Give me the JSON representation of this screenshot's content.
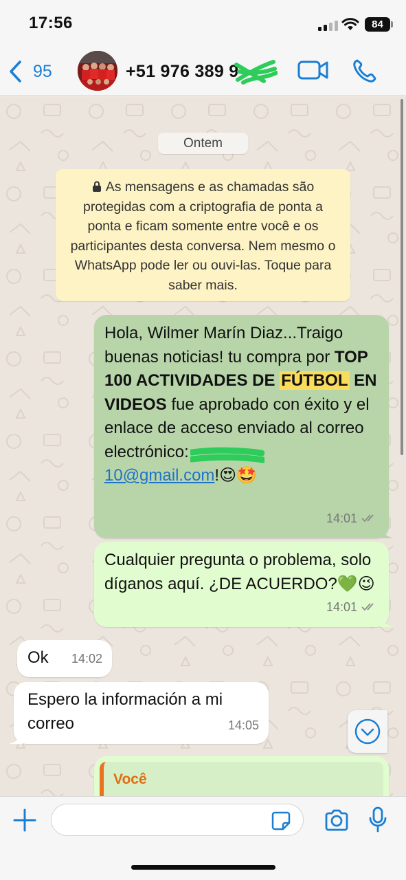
{
  "status_bar": {
    "time": "17:56",
    "battery": "84"
  },
  "header": {
    "back_count": "95",
    "contact_name": "+51 976 389 9",
    "icons": [
      "chevron-left-icon",
      "video-call-icon",
      "phone-icon"
    ]
  },
  "chat": {
    "date_chip": "Ontem",
    "encryption_notice": "As mensagens e as chamadas são protegidas com a criptografia de ponta a ponta e ficam somente entre você e os participantes desta conversa. Nem mesmo o WhatsApp pode ler ou ouvi-las. Toque para saber mais.",
    "messages": [
      {
        "direction": "outgoing",
        "greeting": "Hola, Wilmer Marín Diaz...Traigo buenas noticias! tu compra por ",
        "product_part1": "TOP 100 ACTIVIDADES DE ",
        "product_highlight": "FÚTBOL",
        "product_part2": " EN VIDEOS",
        "body": " fue aprobado con éxito y el enlace de acceso enviado al correo electrónico: ",
        "email": "10@gmail.com",
        "suffix": "!😍🤩",
        "time": "14:01",
        "status": "read"
      },
      {
        "direction": "outgoing",
        "text": "Cualquier pregunta o problema, solo díganos aquí. ¿DE ACUERDO?💚😉",
        "time": "14:01",
        "status": "read"
      },
      {
        "direction": "incoming",
        "text": "Ok",
        "time": "14:02"
      },
      {
        "direction": "incoming",
        "text": "Espero la información a mi correo",
        "time": "14:05"
      },
      {
        "direction": "outgoing",
        "quote_author": "Você"
      }
    ]
  },
  "input_bar": {
    "placeholder": ""
  },
  "colors": {
    "accent": "#1a7fd4",
    "outgoing_bubble": "#e1fdd0",
    "outgoing_bubble_selected": "#b8d5aa",
    "incoming_bubble": "#ffffff",
    "encryption_bg": "#fdf3c4",
    "quote_author": "#e06d12"
  }
}
